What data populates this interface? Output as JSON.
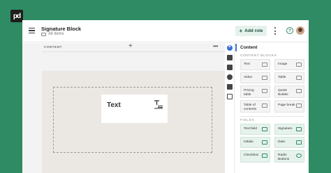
{
  "logo": {
    "text": "pd"
  },
  "header": {
    "title": "Signature Block",
    "folder": "All items",
    "add_role_label": "Add role",
    "help": "?"
  },
  "canvas": {
    "content_label": "CONTENT",
    "add_symbol": "+",
    "more_symbol": "•••",
    "text_block_label": "Text"
  },
  "panel": {
    "title": "Content",
    "content_blocks_label": "CONTENT BLOCKS",
    "fields_label": "FIELDS",
    "blocks": [
      {
        "label": "Text",
        "icon": "text-icon"
      },
      {
        "label": "Image",
        "icon": "image-icon"
      },
      {
        "label": "Video",
        "icon": "video-icon"
      },
      {
        "label": "Table",
        "icon": "table-icon"
      },
      {
        "label": "Pricing table",
        "icon": "pricing-table-icon"
      },
      {
        "label": "Quote Builder",
        "icon": "quote-builder-icon"
      },
      {
        "label": "Table of contents",
        "icon": "toc-icon"
      },
      {
        "label": "Page break",
        "icon": "page-break-icon"
      }
    ],
    "fields": [
      {
        "label": "Text field",
        "icon": "text-field-icon"
      },
      {
        "label": "Signature",
        "icon": "signature-icon"
      },
      {
        "label": "Initials",
        "icon": "initials-icon"
      },
      {
        "label": "Date",
        "icon": "date-icon"
      },
      {
        "label": "Checkbox",
        "icon": "checkbox-icon"
      },
      {
        "label": "Radio Buttons",
        "icon": "radio-icon"
      }
    ]
  },
  "colors": {
    "brand_green": "#2e8b63",
    "accent_blue": "#3b6fd6",
    "section_bg": "#ebe7e2",
    "field_bg": "#e6f2ec"
  }
}
